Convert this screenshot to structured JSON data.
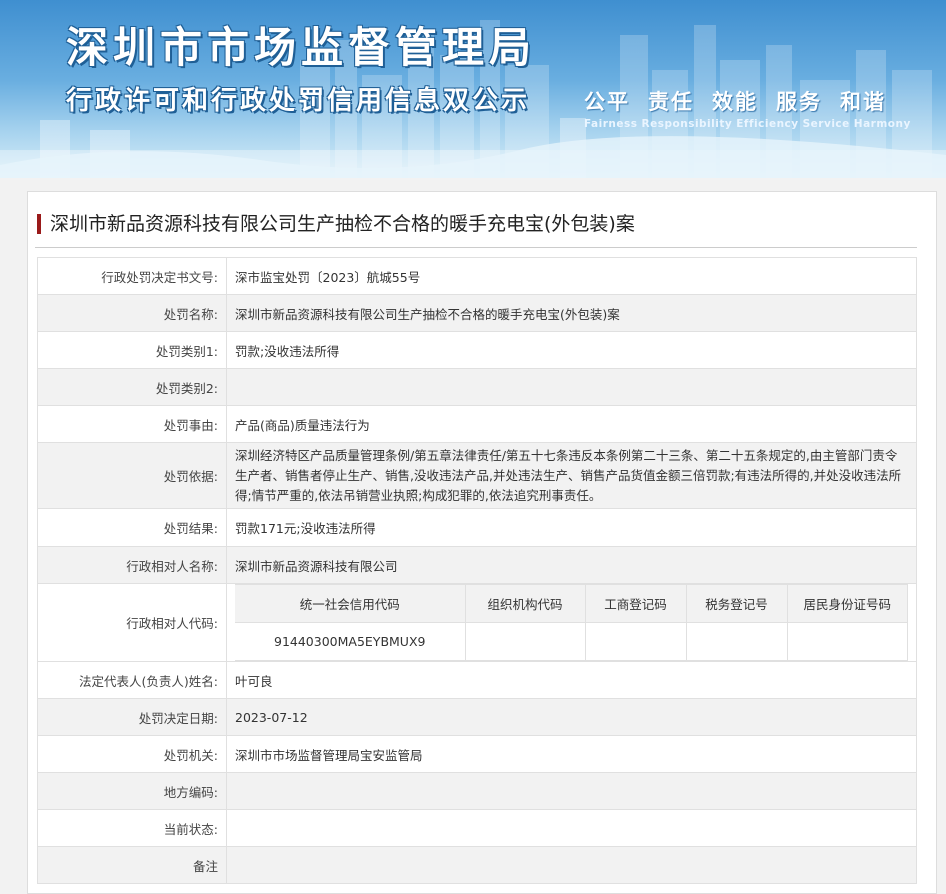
{
  "header": {
    "title": "深圳市市场监督管理局",
    "subtitle": "行政许可和行政处罚信用信息双公示",
    "slogan_cn": [
      "公平",
      "责任",
      "效能",
      "服务",
      "和谐"
    ],
    "slogan_en": [
      "Fairness",
      "Responsibility",
      "Efficiency",
      "Service",
      "Harmony"
    ]
  },
  "case": {
    "title": "深圳市新品资源科技有限公司生产抽检不合格的暖手充电宝(外包装)案"
  },
  "rows": {
    "doc_no": {
      "label": "行政处罚决定书文号:",
      "value": "深市监宝处罚〔2023〕航城55号"
    },
    "name": {
      "label": "处罚名称:",
      "value": "深圳市新品资源科技有限公司生产抽检不合格的暖手充电宝(外包装)案"
    },
    "type1": {
      "label": "处罚类别1:",
      "value": "罚款;没收违法所得"
    },
    "type2": {
      "label": "处罚类别2:",
      "value": ""
    },
    "reason": {
      "label": "处罚事由:",
      "value": "产品(商品)质量违法行为"
    },
    "basis": {
      "label": "处罚依据:",
      "value": "深圳经济特区产品质量管理条例/第五章法律责任/第五十七条违反本条例第二十三条、第二十五条规定的,由主管部门责令生产者、销售者停止生产、销售,没收违法产品,并处违法生产、销售产品货值金额三倍罚款;有违法所得的,并处没收违法所得;情节严重的,依法吊销营业执照;构成犯罪的,依法追究刑事责任。"
    },
    "result": {
      "label": "处罚结果:",
      "value": "罚款171元;没收违法所得"
    },
    "party": {
      "label": "行政相对人名称:",
      "value": "深圳市新品资源科技有限公司"
    },
    "party_code": {
      "label": "行政相对人代码:",
      "headers": [
        "统一社会信用代码",
        "组织机构代码",
        "工商登记码",
        "税务登记号",
        "居民身份证号码"
      ],
      "values": [
        "91440300MA5EYBMUX9",
        "",
        "",
        "",
        ""
      ]
    },
    "legal_rep": {
      "label": "法定代表人(负责人)姓名:",
      "value": "叶可良"
    },
    "date": {
      "label": "处罚决定日期:",
      "value": "2023-07-12"
    },
    "authority": {
      "label": "处罚机关:",
      "value": "深圳市市场监督管理局宝安监管局"
    },
    "region": {
      "label": "地方编码:",
      "value": ""
    },
    "status": {
      "label": "当前状态:",
      "value": ""
    },
    "remark": {
      "label": "备注",
      "value": ""
    }
  },
  "colors": {
    "accent": "#9a1a1a",
    "banner_blue": "#3f8fd0",
    "row_alt": "#f2f2f2"
  }
}
